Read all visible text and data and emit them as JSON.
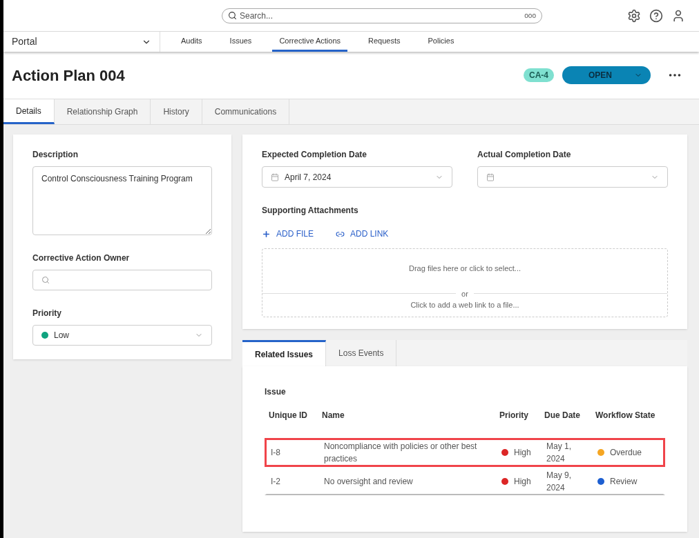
{
  "search": {
    "placeholder": "Search...",
    "more": "ooo"
  },
  "nav": {
    "portal": "Portal",
    "items": [
      {
        "label": "Audits",
        "selected": false
      },
      {
        "label": "Issues",
        "selected": false
      },
      {
        "label": "Corrective Actions",
        "selected": true
      },
      {
        "label": "Requests",
        "selected": false
      },
      {
        "label": "Policies",
        "selected": false
      }
    ]
  },
  "header": {
    "title": "Action Plan 004",
    "badge": "CA-4",
    "status": "OPEN"
  },
  "tabs": [
    {
      "label": "Details",
      "selected": true
    },
    {
      "label": "Relationship Graph",
      "selected": false
    },
    {
      "label": "History",
      "selected": false
    },
    {
      "label": "Communications",
      "selected": false
    }
  ],
  "left": {
    "description_label": "Description",
    "description": "Control Consciousness Training Program",
    "owner_label": "Corrective Action Owner",
    "priority_label": "Priority",
    "priority": {
      "label": "Low",
      "color": "#0fa37f"
    }
  },
  "dates": {
    "expected_label": "Expected Completion Date",
    "expected": "April 7, 2024",
    "actual_label": "Actual Completion Date"
  },
  "attachments": {
    "label": "Supporting Attachments",
    "add_file": "ADD FILE",
    "add_link": "ADD LINK",
    "drop": "Drag files here or click to select...",
    "or": "or",
    "web": "Click to add a web link to a file..."
  },
  "related": {
    "tabs": [
      {
        "label": "Related Issues",
        "selected": true
      },
      {
        "label": "Loss Events",
        "selected": false
      }
    ],
    "caption": "Issue",
    "columns": [
      "Unique ID",
      "Name",
      "Priority",
      "Due Date",
      "Workflow State"
    ],
    "rows": [
      {
        "id": "I-8",
        "name": "Noncompliance with policies or other best practices",
        "priority": {
          "label": "High",
          "color": "#dc2626"
        },
        "due": "May 1, 2024",
        "state": {
          "label": "Overdue",
          "color": "#f5a623"
        },
        "highlighted": true
      },
      {
        "id": "I-2",
        "name": "No oversight and review",
        "priority": {
          "label": "High",
          "color": "#dc2626"
        },
        "due": "May 9, 2024",
        "state": {
          "label": "Review",
          "color": "#1d5fd1"
        },
        "highlighted": false
      }
    ]
  }
}
